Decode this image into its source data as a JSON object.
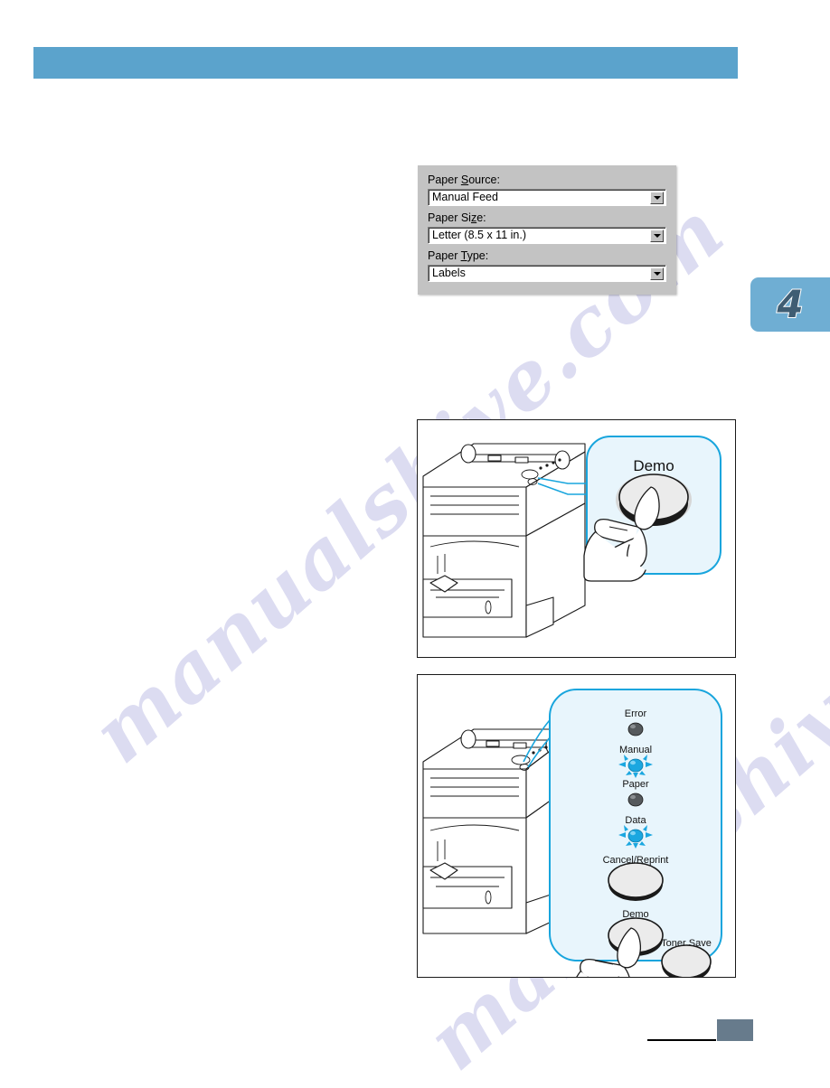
{
  "page": {
    "watermark": "manualshive.com",
    "header_title": "",
    "chapter_number": "4",
    "footer_page_label": ""
  },
  "dialog": {
    "name": "paper-options",
    "fields": [
      {
        "label": "Paper Source:",
        "accel_before": "Paper ",
        "accel_char": "S",
        "accel_after": "ource:",
        "value": "Manual Feed",
        "arrow_icon": "chevron-down-icon"
      },
      {
        "label": "Paper Size:",
        "accel_before": "Paper Si",
        "accel_char": "z",
        "accel_after": "e:",
        "value": "Letter (8.5 x 11 in.)",
        "arrow_icon": "chevron-down-icon"
      },
      {
        "label": "Paper Type:",
        "accel_before": "Paper ",
        "accel_char": "T",
        "accel_after": "ype:",
        "value": "Labels",
        "arrow_icon": "chevron-down-icon"
      }
    ]
  },
  "illustration_demo": {
    "callout_label": "Demo"
  },
  "illustration_panel": {
    "indicators": [
      {
        "label": "Error",
        "state": "off"
      },
      {
        "label": "Manual",
        "state": "on"
      },
      {
        "label": "Paper",
        "state": "off"
      },
      {
        "label": "Data",
        "state": "on"
      }
    ],
    "buttons": [
      {
        "label": "Cancel/Reprint"
      },
      {
        "label": "Demo"
      },
      {
        "label": "Toner Save"
      }
    ]
  },
  "colors": {
    "header_bar": "#5ba3cc",
    "chapter_tab": "#6faed3",
    "callout_fill": "#e8f5fc",
    "callout_stroke": "#18a5dd",
    "led_on": "#1ba7e0",
    "led_off": "#55595c",
    "dialog_face": "#c3c3c3",
    "footer_block": "#677b8c",
    "watermark": "#8f8fd4"
  }
}
